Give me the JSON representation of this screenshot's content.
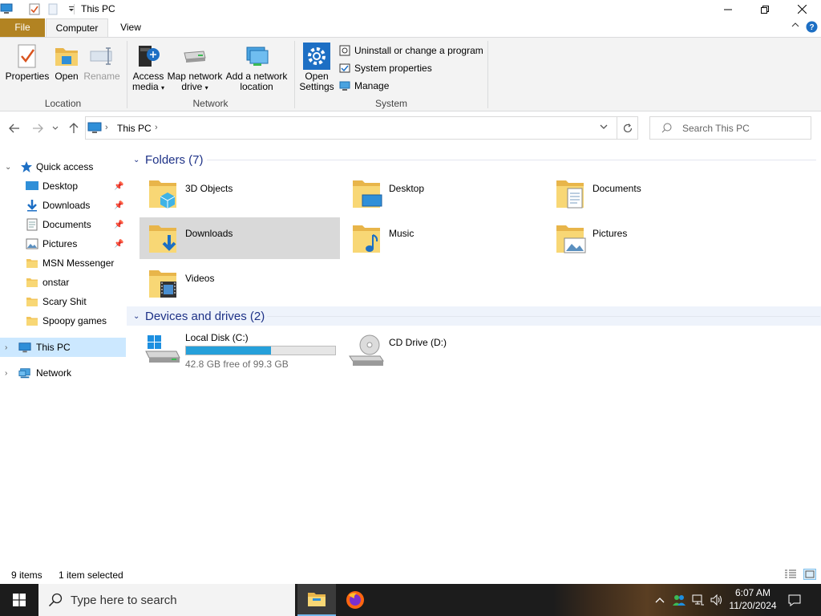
{
  "window": {
    "title": "This PC"
  },
  "ribbon_tabs": {
    "file": "File",
    "computer": "Computer",
    "view": "View"
  },
  "ribbon": {
    "location": {
      "label": "Location",
      "properties": "Properties",
      "open": "Open",
      "rename": "Rename"
    },
    "network": {
      "label": "Network",
      "access_media_1": "Access",
      "access_media_2": "media",
      "map_drive_1": "Map network",
      "map_drive_2": "drive",
      "add_location_1": "Add a network",
      "add_location_2": "location"
    },
    "system": {
      "label": "System",
      "open_settings_1": "Open",
      "open_settings_2": "Settings",
      "uninstall": "Uninstall or change a program",
      "system_properties": "System properties",
      "manage": "Manage"
    }
  },
  "address": {
    "path": "This PC",
    "search_placeholder": "Search This PC"
  },
  "nav_pane": {
    "quick_access": "Quick access",
    "items": [
      {
        "label": "Desktop",
        "pinned": true
      },
      {
        "label": "Downloads",
        "pinned": true
      },
      {
        "label": "Documents",
        "pinned": true
      },
      {
        "label": "Pictures",
        "pinned": true
      },
      {
        "label": "MSN Messenger",
        "pinned": false
      },
      {
        "label": "onstar",
        "pinned": false
      },
      {
        "label": "Scary Shit",
        "pinned": false
      },
      {
        "label": "Spoopy games",
        "pinned": false
      }
    ],
    "this_pc": "This PC",
    "network": "Network"
  },
  "content": {
    "folders_header": "Folders (7)",
    "folders": [
      {
        "name": "3D Objects",
        "icon": "3d-objects-icon"
      },
      {
        "name": "Desktop",
        "icon": "desktop-folder-icon"
      },
      {
        "name": "Documents",
        "icon": "documents-folder-icon"
      },
      {
        "name": "Downloads",
        "icon": "downloads-folder-icon",
        "selected": true
      },
      {
        "name": "Music",
        "icon": "music-folder-icon"
      },
      {
        "name": "Pictures",
        "icon": "pictures-folder-icon"
      },
      {
        "name": "Videos",
        "icon": "videos-folder-icon"
      }
    ],
    "drives_header": "Devices and drives (2)",
    "drives": [
      {
        "name": "Local Disk (C:)",
        "free_text": "42.8 GB free of 99.3 GB",
        "used_fraction": 0.569
      },
      {
        "name": "CD Drive (D:)"
      }
    ]
  },
  "status": {
    "item_count": "9 items",
    "selection": "1 item selected"
  },
  "taskbar": {
    "search_placeholder": "Type here to search",
    "time": "6:07 AM",
    "date": "11/20/2024"
  },
  "colors": {
    "accent": "#26a0da",
    "file_tab": "#b28322",
    "selection": "#cce8ff",
    "folder": "#f2c55c"
  }
}
